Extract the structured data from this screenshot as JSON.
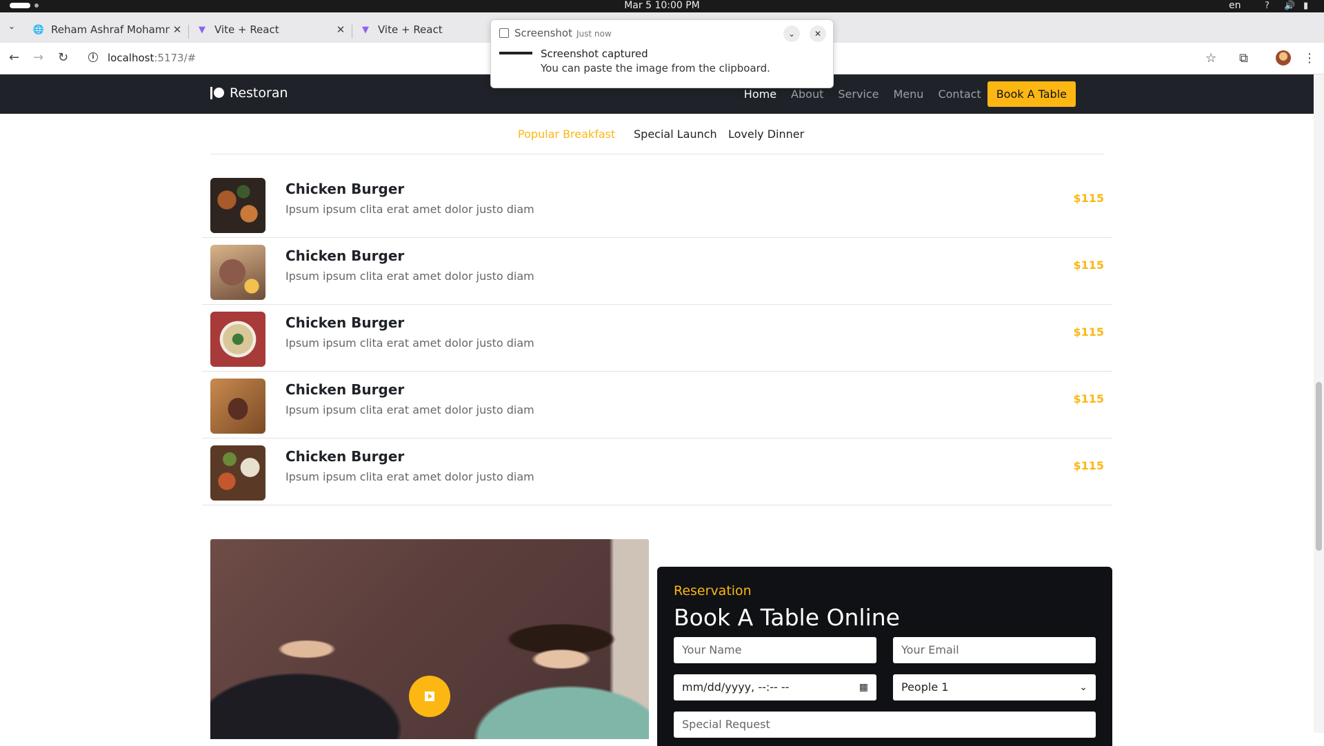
{
  "os": {
    "datetime": "Mar 5  10:00 PM",
    "lang": "en"
  },
  "browser": {
    "tabs": [
      {
        "title": "Reham Ashraf Mohammed",
        "icon": "globe-icon"
      },
      {
        "title": "Vite + React",
        "icon": "vite-icon"
      },
      {
        "title": "Vite + React",
        "icon": "vite-icon"
      }
    ],
    "url_host": "localhost",
    "url_rest": ":5173/#"
  },
  "notification": {
    "app": "Screenshot",
    "when": "Just now",
    "title": "Screenshot captured",
    "body": "You can paste the image from the clipboard."
  },
  "site": {
    "brand": "Restoran",
    "nav": [
      {
        "label": "Home",
        "active": true
      },
      {
        "label": "About"
      },
      {
        "label": "Service"
      },
      {
        "label": "Menu"
      },
      {
        "label": "Contact"
      }
    ],
    "cta": "Book A Table",
    "menu_tabs": [
      {
        "label": "Popular Breakfast",
        "active": true
      },
      {
        "label": "Special Launch"
      },
      {
        "label": "Lovely Dinner"
      }
    ],
    "menu_items": [
      {
        "name": "Chicken Burger",
        "desc": "Ipsum ipsum clita erat amet dolor justo diam",
        "price": "$115"
      },
      {
        "name": "Chicken Burger",
        "desc": "Ipsum ipsum clita erat amet dolor justo diam",
        "price": "$115"
      },
      {
        "name": "Chicken Burger",
        "desc": "Ipsum ipsum clita erat amet dolor justo diam",
        "price": "$115"
      },
      {
        "name": "Chicken Burger",
        "desc": "Ipsum ipsum clita erat amet dolor justo diam",
        "price": "$115"
      },
      {
        "name": "Chicken Burger",
        "desc": "Ipsum ipsum clita erat amet dolor justo diam",
        "price": "$115"
      }
    ],
    "reservation": {
      "subtitle": "Reservation",
      "title": "Book A Table Online",
      "name_placeholder": "Your Name",
      "email_placeholder": "Your Email",
      "datetime_placeholder": "mm/dd/yyyy, --:-- --",
      "people_value": "People 1",
      "request_placeholder": "Special Request"
    }
  },
  "colors": {
    "accent": "#fcb712",
    "nav_bg": "#1f2228",
    "form_bg": "#0f1115"
  }
}
